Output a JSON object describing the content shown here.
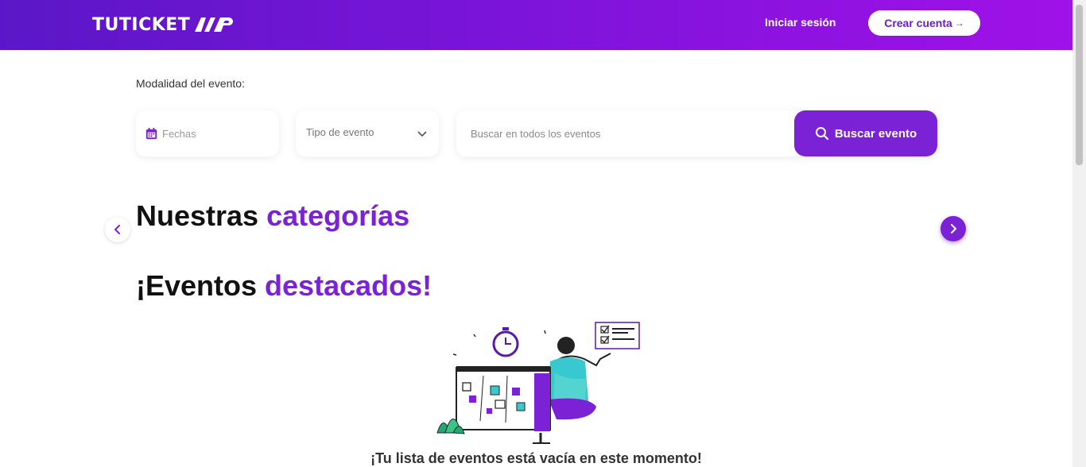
{
  "header": {
    "logo_text": "TUTICKET",
    "login_label": "Iniciar sesión",
    "signup_label": "Crear cuenta",
    "signup_arrow": "→"
  },
  "filters": {
    "mode_label": "Modalidad del evento:",
    "date_placeholder": "Fechas",
    "type_placeholder": "Tipo de evento",
    "search_placeholder": "Buscar en todos los eventos",
    "search_button": "Buscar evento"
  },
  "categories": {
    "title_plain": "Nuestras ",
    "title_accent": "categorías"
  },
  "featured": {
    "title_plain": "¡Eventos ",
    "title_accent": "destacados!",
    "empty_message": "¡Tu lista de eventos está vacía en este momento!"
  },
  "colors": {
    "brand_purple": "#7b22d6",
    "header_start": "#5b17c7",
    "header_end": "#a011e8"
  }
}
